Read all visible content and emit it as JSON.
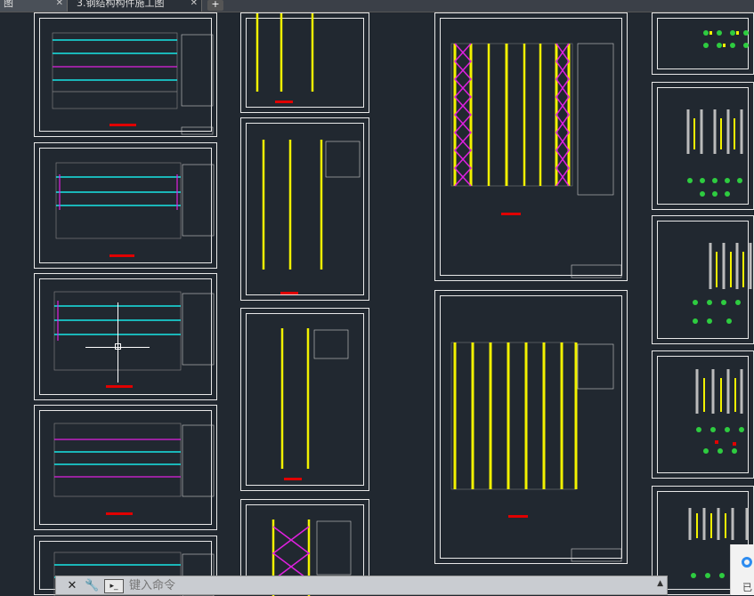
{
  "tabs": {
    "prev_tab_label": "图",
    "active_tab_label": "3.钢结构构件施工图",
    "new_tab_label": "+"
  },
  "command_line": {
    "placeholder": "键入命令",
    "prompt_symbol": "▸_"
  },
  "notification": {
    "text": "已"
  },
  "colors": {
    "background": "#212830",
    "frame": "#e8e8e8",
    "cyan_beam": "#19e6e6",
    "yellow_column": "#f2f200",
    "magenta_brace": "#e020e0",
    "red_label": "#e00000",
    "green_node": "#2ecc40"
  }
}
